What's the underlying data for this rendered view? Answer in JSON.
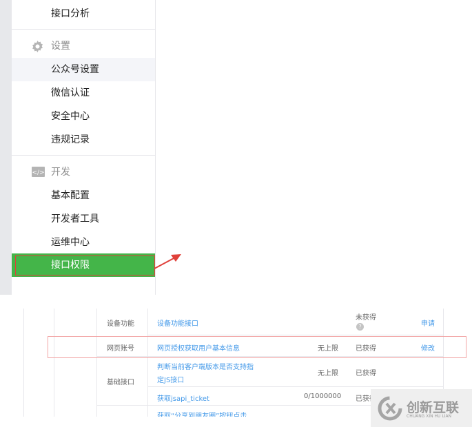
{
  "sidebar": {
    "top_item": "接口分析",
    "settings": {
      "label": "设置",
      "items": [
        "公众号设置",
        "微信认证",
        "安全中心",
        "违规记录"
      ]
    },
    "develop": {
      "label": "开发",
      "items": [
        "基本配置",
        "开发者工具",
        "运维中心",
        "接口权限"
      ]
    }
  },
  "table": {
    "rows": [
      {
        "category": "设备功能",
        "name": "设备功能接口",
        "limit": "",
        "status": "未获得",
        "action": "申请"
      },
      {
        "category": "网页账号",
        "name": "网页授权获取用户基本信息",
        "limit": "无上限",
        "status": "已获得",
        "action": "修改"
      },
      {
        "category": "基础接口",
        "name": "判断当前客户端版本是否支持指定JS接口",
        "name_line1": "判断当前客户端版本是否支持指",
        "name_line2": "定JS接口",
        "limit": "无上限",
        "status": "已获得",
        "action": ""
      },
      {
        "category": "",
        "name": "获取jsapi_ticket",
        "limit": "0/1000000",
        "status": "已获得",
        "action": ""
      },
      {
        "category": "",
        "name": "获取“分享到朋友圈”按钮点击",
        "limit": "",
        "status": "",
        "action": ""
      }
    ]
  },
  "watermark": {
    "name": "创新互联",
    "sub": "CHUANG XIN HU LIAN"
  },
  "colors": {
    "active": "#44b549",
    "link": "#459ae9",
    "highlight": "#e0403a"
  }
}
